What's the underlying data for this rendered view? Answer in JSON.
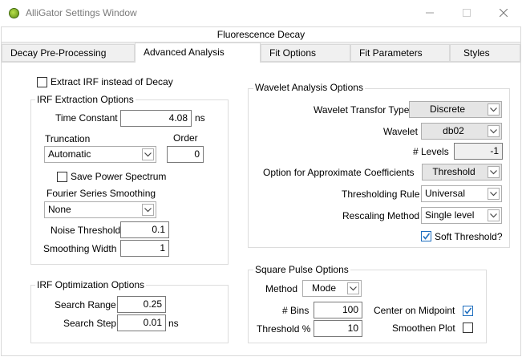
{
  "window": {
    "title": "AlliGator Settings Window"
  },
  "section_header": "Fluorescence Decay",
  "tabs": [
    {
      "label": "Decay Pre-Processing"
    },
    {
      "label": "Advanced Analysis"
    },
    {
      "label": "Fit Options"
    },
    {
      "label": "Fit Parameters"
    },
    {
      "label": "Styles"
    }
  ],
  "extract_irf": {
    "label": "Extract IRF instead of Decay",
    "checked": false
  },
  "irf_extraction": {
    "title": "IRF Extraction Options",
    "time_constant_label": "Time Constant",
    "time_constant_value": "4.08",
    "time_constant_unit": "ns",
    "truncation_label": "Truncation",
    "truncation_value": "Automatic",
    "order_label": "Order",
    "order_value": "0",
    "save_power_spectrum_label": "Save Power Spectrum",
    "save_power_spectrum_checked": false,
    "fourier_label": "Fourier Series Smoothing",
    "fourier_value": "None",
    "noise_threshold_label": "Noise Threshold",
    "noise_threshold_value": "0.1",
    "smoothing_width_label": "Smoothing Width",
    "smoothing_width_value": "1"
  },
  "irf_optimization": {
    "title": "IRF Optimization Options",
    "search_range_label": "Search Range",
    "search_range_value": "0.25",
    "search_step_label": "Search Step",
    "search_step_value": "0.01",
    "search_step_unit": "ns"
  },
  "wavelet": {
    "title": "Wavelet Analysis Options",
    "transform_type_label": "Wavelet Transfor Type",
    "transform_type_value": "Discrete",
    "wavelet_label": "Wavelet",
    "wavelet_value": "db02",
    "levels_label": "# Levels",
    "levels_value": "-1",
    "approx_coeff_label": "Option for Approximate Coefficients",
    "approx_coeff_value": "Threshold",
    "thresholding_rule_label": "Thresholding Rule",
    "thresholding_rule_value": "Universal",
    "rescaling_label": "Rescaling Method",
    "rescaling_value": "Single level",
    "soft_threshold_label": "Soft Threshold?",
    "soft_threshold_checked": true
  },
  "square_pulse": {
    "title": "Square Pulse Options",
    "method_label": "Method",
    "method_value": "Mode",
    "bins_label": "# Bins",
    "bins_value": "100",
    "threshold_label": "Threshold %",
    "threshold_value": "10",
    "center_label": "Center on Midpoint",
    "center_checked": true,
    "smoothen_label": "Smoothen Plot",
    "smoothen_checked": false
  },
  "colors": {
    "accent": "#1f6fbf",
    "border": "#dcdcdc",
    "panel": "#ffffff",
    "chrome": "#f0f0f0"
  }
}
